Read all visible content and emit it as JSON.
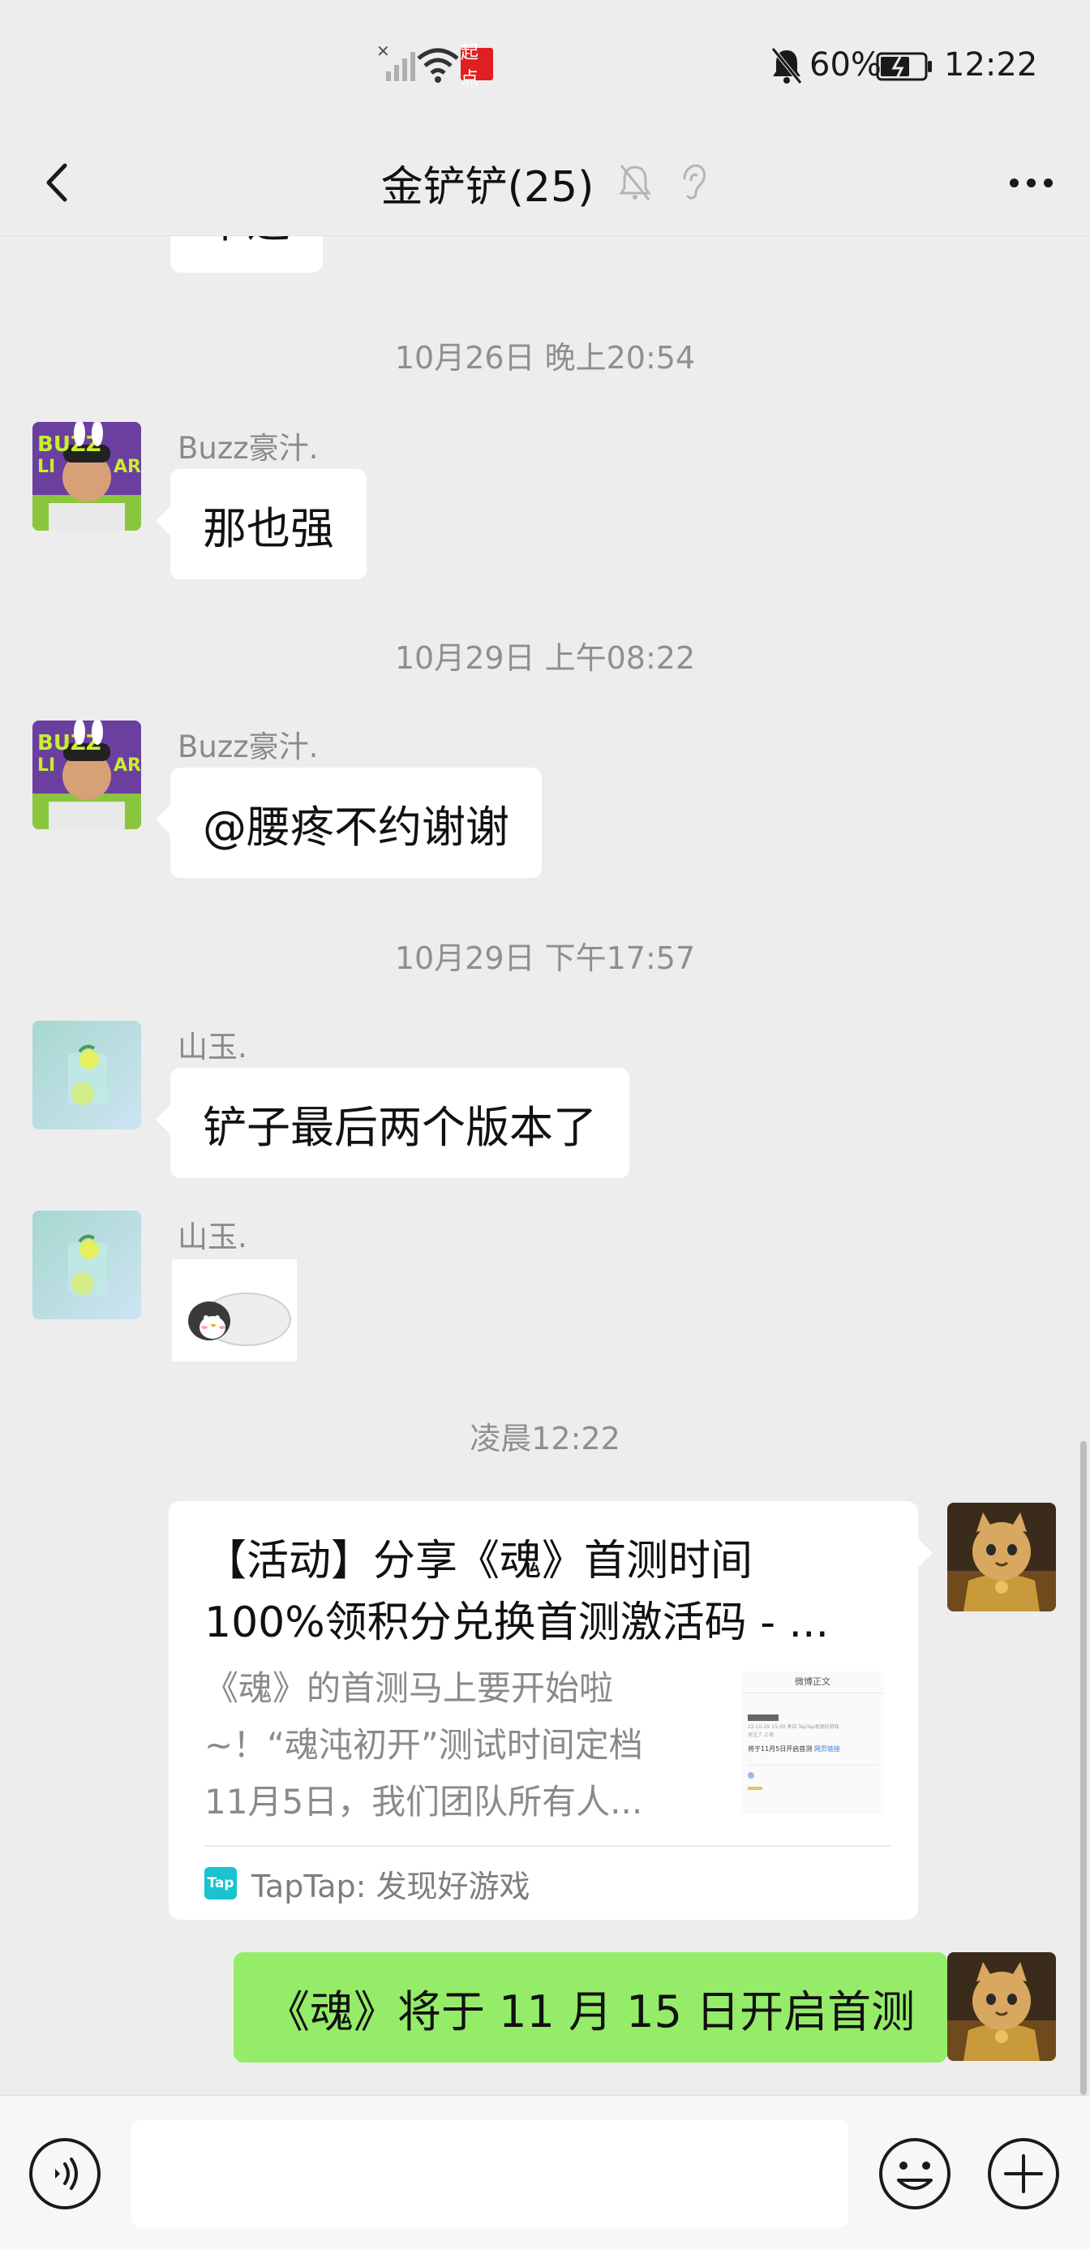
{
  "status_bar": {
    "carrier_badge": "起点",
    "battery": "60%",
    "time": "12:22"
  },
  "chat": {
    "title": "金铲铲(25)"
  },
  "messages": {
    "partial_top": "牛逼",
    "ts1": "10月26日 晚上20:54",
    "m1_sender": "Buzz豪汁.",
    "m1_text": "那也强",
    "ts2": "10月29日 上午08:22",
    "m2_sender": "Buzz豪汁.",
    "m2_text": "@腰疼不约谢谢",
    "ts3": "10月29日 下午17:57",
    "m3_sender": "山玉.",
    "m3_text": "铲子最后两个版本了",
    "m4_sender": "山玉.",
    "ts4": "凌晨12:22",
    "card": {
      "title_line1": "【活动】分享《魂》首测时间",
      "title_line2": "100%领积分兑换首测激活码 - ...",
      "desc_line1": "《魂》的首测马上要开始啦",
      "desc_line2": "~！“魂沌初开”测试时间定档",
      "desc_line3": "11月5日，我们团队所有人...",
      "thumb_header": "微博正文",
      "thumb_meta1": "22-10-29 15:30  来自 TapTap发现好游戏",
      "thumb_meta2": "关注了 上海",
      "thumb_line": "将于11月5日开启首测",
      "thumb_link": "网页链接",
      "source": "TapTap: 发现好游戏",
      "source_logo_text": "Tap"
    },
    "m5_text": "《魂》将于 11 月 15 日开启首测"
  },
  "colors": {
    "background": "#ededed",
    "bubble_out": "#95ec69",
    "bubble_in": "#ffffff",
    "taptap": "#19c3cf"
  },
  "icons": {
    "back": "chevron-left-icon",
    "mute": "bell-off-icon",
    "ear": "ear-icon",
    "more": "more-dots-icon",
    "voice": "voice-icon",
    "emoji": "emoji-icon",
    "add": "plus-circle-icon"
  }
}
